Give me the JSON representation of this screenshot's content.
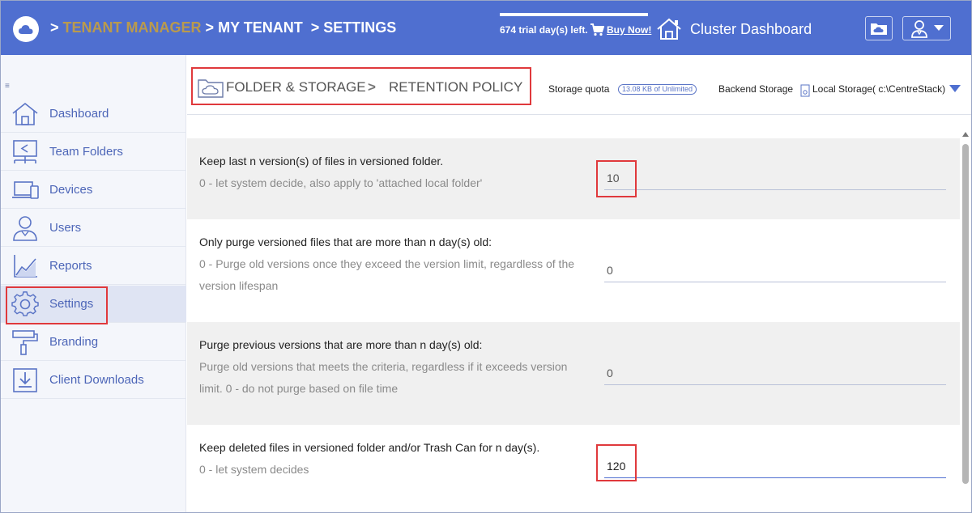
{
  "topbar": {
    "crumbs": [
      {
        "label": "TENANT MANAGER"
      },
      {
        "label": "MY TENANT"
      },
      {
        "label": "SETTINGS"
      }
    ],
    "crumb_separator": ">",
    "trial_text": "674 trial day(s) left.",
    "buy_label": "Buy Now!",
    "cluster_label": "Cluster Dashboard",
    "colors": {
      "bar": "#4f6fd0",
      "first_crumb": "#b99a4e"
    }
  },
  "sidebar": {
    "collapse_icon": "collapse-icon",
    "items": [
      {
        "label": "Dashboard",
        "icon": "home-icon"
      },
      {
        "label": "Team Folders",
        "icon": "team-folders-icon"
      },
      {
        "label": "Devices",
        "icon": "devices-icon"
      },
      {
        "label": "Users",
        "icon": "users-icon"
      },
      {
        "label": "Reports",
        "icon": "reports-icon"
      },
      {
        "label": "Settings",
        "icon": "gear-icon",
        "active": true
      },
      {
        "label": "Branding",
        "icon": "paint-roller-icon"
      },
      {
        "label": "Client Downloads",
        "icon": "download-icon"
      }
    ]
  },
  "content": {
    "path": [
      "FOLDER & STORAGE",
      "RETENTION POLICY"
    ],
    "path_separator": ">",
    "storage_quota_label": "Storage quota",
    "storage_quota_value": "13.08 KB of Unlimited",
    "backend_storage_label": "Backend Storage",
    "backend_storage_value": "Local Storage( c:\\CentreStack)"
  },
  "settings": [
    {
      "title": "Keep last n version(s) of files in versioned folder.",
      "description": "0 - let system decide, also apply to 'attached local folder'",
      "value": "10"
    },
    {
      "title": "Only purge versioned files that are more than n day(s) old:",
      "description": "0 - Purge old versions once they exceed the version limit, regardless of the version lifespan",
      "value": "0"
    },
    {
      "title": "Purge previous versions that are more than n day(s) old:",
      "description": "Purge old versions that meets the criteria, regardless if it exceeds version limit. 0 - do not purge based on file time",
      "value": "0"
    },
    {
      "title": "Keep deleted files in versioned folder and/or Trash Can for n day(s).",
      "description": "0 - let system decides",
      "value": "120"
    }
  ]
}
